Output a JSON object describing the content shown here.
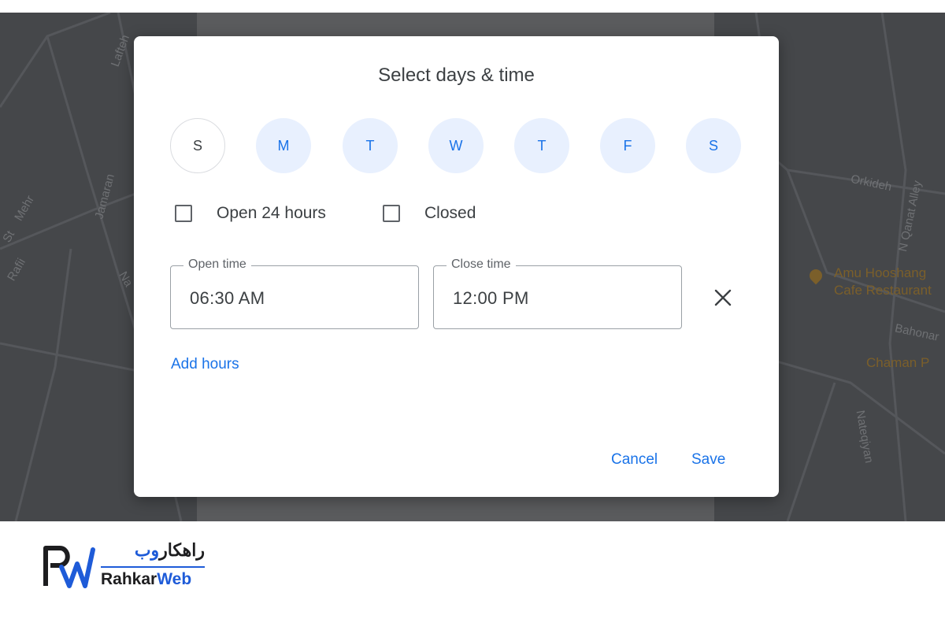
{
  "dialog": {
    "title": "Select days & time",
    "days": [
      {
        "letter": "S",
        "selected": false
      },
      {
        "letter": "M",
        "selected": true
      },
      {
        "letter": "T",
        "selected": true
      },
      {
        "letter": "W",
        "selected": true
      },
      {
        "letter": "T",
        "selected": true
      },
      {
        "letter": "F",
        "selected": true
      },
      {
        "letter": "S",
        "selected": true
      }
    ],
    "open_24_hours_label": "Open 24 hours",
    "closed_label": "Closed",
    "open_time": {
      "label": "Open time",
      "value": "06:30 AM"
    },
    "close_time": {
      "label": "Close time",
      "value": "12:00 PM"
    },
    "add_hours_label": "Add hours",
    "cancel_label": "Cancel",
    "save_label": "Save"
  },
  "map": {
    "streets": [
      "Lafteh",
      "Mehr",
      "St",
      "Rafii",
      "Jamaran",
      "Na",
      "Orkideh",
      "N Qanat Alley",
      "Bahonar",
      "Nateqiyan"
    ],
    "pois": [
      "Amu Hooshang",
      "Cafe Restaurant",
      "Chaman P"
    ]
  },
  "brand": {
    "name_fa_dark": "راهکار",
    "name_fa_accent": "وب",
    "name_en_dark": "Rahkar",
    "name_en_accent": "Web"
  },
  "colors": {
    "accent": "#1a73e8",
    "day_selected_bg": "#e8f0fe",
    "text": "#3c4043",
    "brand_blue": "#1e5bd8"
  }
}
